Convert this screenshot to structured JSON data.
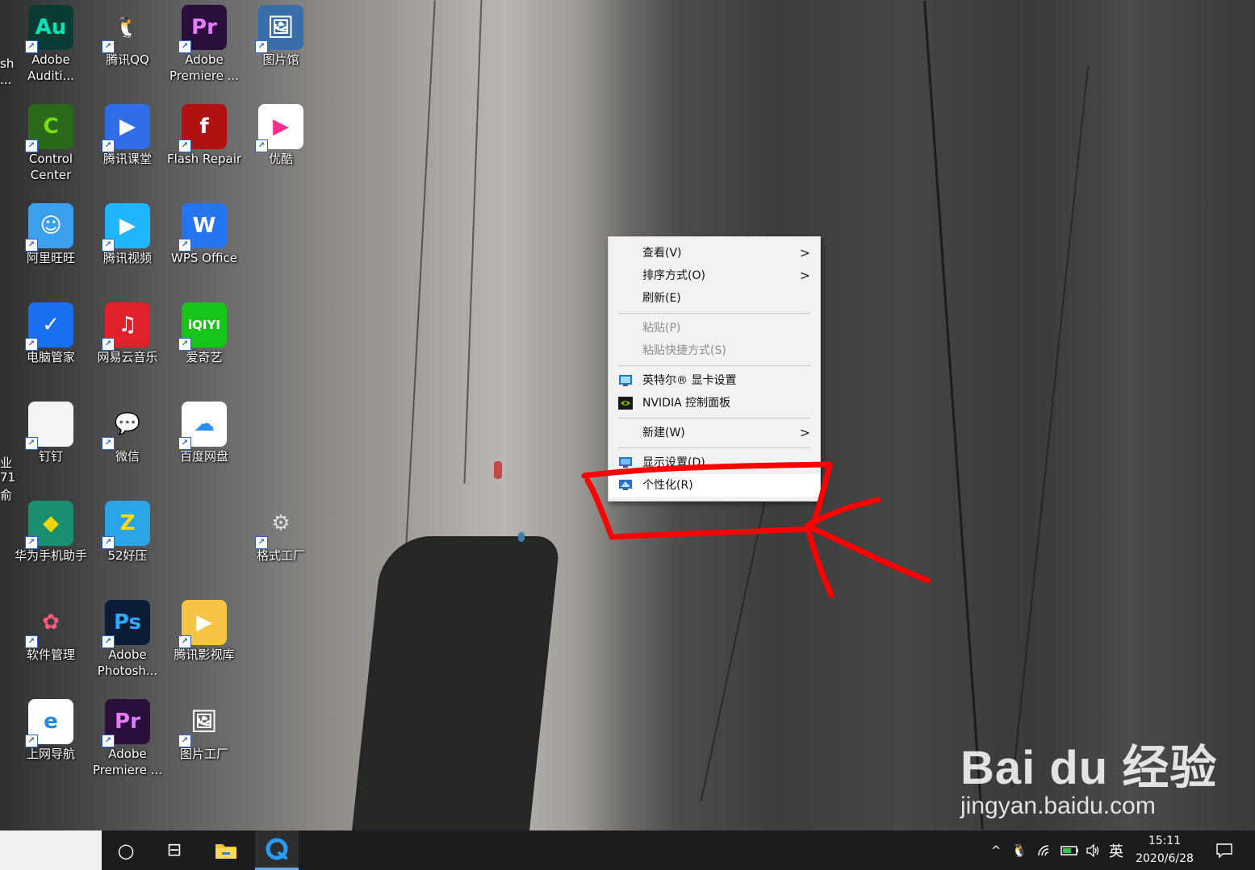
{
  "desktop": {
    "icons": [
      {
        "label": "Adobe\nAuditi...",
        "glyph": "Au",
        "color": "#0a3c33",
        "fg": "#00e4bb"
      },
      {
        "label": "腾讯QQ",
        "glyph": "🐧",
        "color": "transparent",
        "fg": "#000"
      },
      {
        "label": "Adobe\nPremiere ...",
        "glyph": "Pr",
        "color": "#2a0f3c",
        "fg": "#e57bff"
      },
      {
        "label": "图片馆",
        "glyph": "🖼",
        "color": "#3a6ea8",
        "fg": "#fff"
      },
      {
        "label": "Control\nCenter",
        "glyph": "C",
        "color": "#2a6a1a",
        "fg": "#7be000"
      },
      {
        "label": "腾讯课堂",
        "glyph": "▶",
        "color": "#2f6ee6",
        "fg": "#fff"
      },
      {
        "label": "Flash Repair",
        "glyph": "f",
        "color": "#b01212",
        "fg": "#fff"
      },
      {
        "label": "优酷",
        "glyph": "▶",
        "color": "#ffffff",
        "fg": "#ff2d8a"
      },
      {
        "label": "阿里旺旺",
        "glyph": "☺",
        "color": "#3aa0ee",
        "fg": "#fff"
      },
      {
        "label": "腾讯视频",
        "glyph": "▶",
        "color": "#1fb6ff",
        "fg": "#fff"
      },
      {
        "label": "WPS Office",
        "glyph": "W",
        "color": "#2574f0",
        "fg": "#fff"
      },
      {
        "label": "电脑管家",
        "glyph": "✓",
        "color": "#1a6ff0",
        "fg": "#fff"
      },
      {
        "label": "网易云音乐",
        "glyph": "♫",
        "color": "#e0202a",
        "fg": "#fff"
      },
      {
        "label": "爱奇艺",
        "glyph": "iQIYI",
        "color": "#17c418",
        "fg": "#fff"
      },
      {
        "label": "钉钉",
        "glyph": "",
        "color": "#f4f4f4",
        "fg": "#888"
      },
      {
        "label": "微信",
        "glyph": "💬",
        "color": "transparent",
        "fg": "#fff"
      },
      {
        "label": "百度网盘",
        "glyph": "☁",
        "color": "#ffffff",
        "fg": "#2b8ef0"
      },
      {
        "label": "华为手机助手",
        "glyph": "◆",
        "color": "#1a8f6f",
        "fg": "#f2d400"
      },
      {
        "label": "52好压",
        "glyph": "Z",
        "color": "#2aa6e8",
        "fg": "#ffdc00"
      },
      {
        "label": "格式工厂",
        "glyph": "⚙",
        "color": "transparent",
        "fg": "#ddd"
      },
      {
        "label": "软件管理",
        "glyph": "✿",
        "color": "transparent",
        "fg": "#ff5a7a"
      },
      {
        "label": "Adobe\nPhotosh...",
        "glyph": "Ps",
        "color": "#0c1e36",
        "fg": "#31a8ff"
      },
      {
        "label": "腾讯影视库",
        "glyph": "▶",
        "color": "#f6c545",
        "fg": "#fff"
      },
      {
        "label": "上网导航",
        "glyph": "e",
        "color": "#ffffff",
        "fg": "#1a8be0"
      },
      {
        "label": "Adobe\nPremiere ...",
        "glyph": "Pr",
        "color": "#2a0f3c",
        "fg": "#e57bff"
      },
      {
        "label": "图片工厂",
        "glyph": "🖼",
        "color": "transparent",
        "fg": "#fff"
      }
    ],
    "edge_fragments": [
      "sh",
      "...",
      "业",
      "71",
      "俞"
    ]
  },
  "context_menu": {
    "items": [
      {
        "label": "查看(V)",
        "submenu": true,
        "enabled": true,
        "icon": ""
      },
      {
        "label": "排序方式(O)",
        "submenu": true,
        "enabled": true,
        "icon": ""
      },
      {
        "label": "刷新(E)",
        "submenu": false,
        "enabled": true,
        "icon": ""
      },
      {
        "label": "粘贴(P)",
        "submenu": false,
        "enabled": false,
        "icon": ""
      },
      {
        "label": "粘贴快捷方式(S)",
        "submenu": false,
        "enabled": false,
        "icon": ""
      },
      {
        "label": "英特尔® 显卡设置",
        "submenu": false,
        "enabled": true,
        "icon": "intel-graphics-icon"
      },
      {
        "label": "NVIDIA 控制面板",
        "submenu": false,
        "enabled": true,
        "icon": "nvidia-icon"
      },
      {
        "label": "新建(W)",
        "submenu": true,
        "enabled": true,
        "icon": ""
      },
      {
        "label": "显示设置(D)",
        "submenu": false,
        "enabled": true,
        "icon": "display-settings-icon"
      },
      {
        "label": "个性化(R)",
        "submenu": false,
        "enabled": true,
        "icon": "personalize-icon",
        "highlighted": true
      }
    ],
    "submenu_arrow": ">"
  },
  "taskbar": {
    "cortana_icon": "○",
    "taskview_icon": "⊟",
    "tray": {
      "chevron": "^",
      "ime": "英",
      "time": "15:11",
      "date": "2020/6/28"
    }
  },
  "watermark": {
    "brand": "Bai du 经验",
    "url": "jingyan.baidu.com"
  },
  "colors": {
    "annotation": "#ff0000",
    "menu_bg": "#f2f2f2",
    "taskbar_bg": "#1c1c1e",
    "active_indicator": "#6aa9e8"
  }
}
